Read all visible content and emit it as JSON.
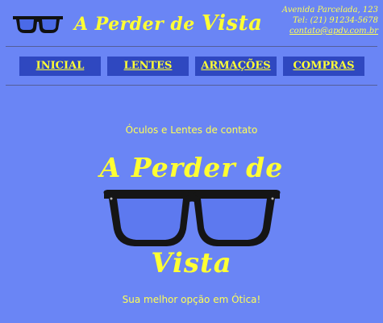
{
  "header": {
    "logo_title_part1": "A Perder de ",
    "logo_title_part2": "Vista",
    "logo_icon": "glasses-icon",
    "contact": {
      "address": "Avenida Parcelada, 123",
      "phone": "Tel: (21) 91234-5678",
      "email": "contato@apdv.com.br"
    }
  },
  "nav": {
    "items": [
      {
        "label": "INICIAL"
      },
      {
        "label": "LENTES"
      },
      {
        "label": "ARMAÇÕES"
      },
      {
        "label": "COMPRAS"
      }
    ]
  },
  "main": {
    "subtitle": "Óculos e Lentes de contato",
    "hero_title_line1": "A Perder de",
    "hero_title_line2": "Vista",
    "hero_image": "glasses-icon",
    "tagline": "Sua melhor opção em Ótica!"
  },
  "colors": {
    "background": "#6a85f5",
    "accent_text": "#ffff33",
    "nav_button": "#2f48c0",
    "frame": "#1a1a1a"
  }
}
